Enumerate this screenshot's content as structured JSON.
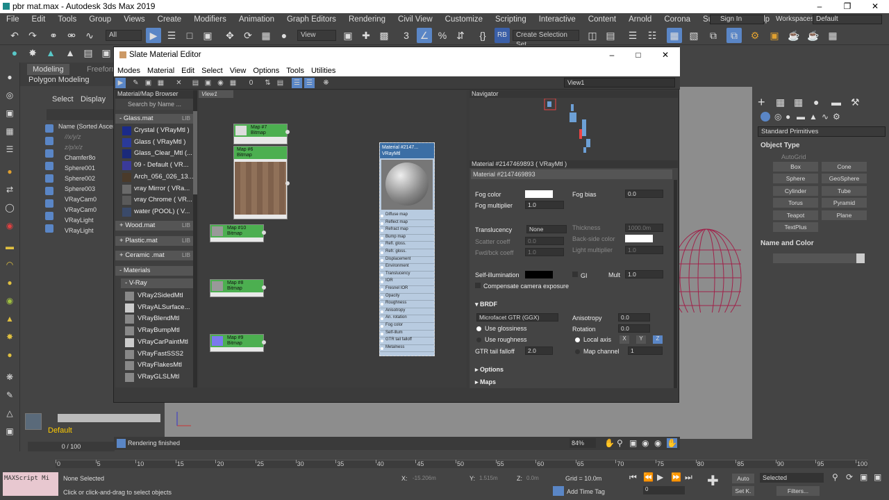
{
  "app": {
    "title": "pbr mat.max - Autodesk 3ds Max 2019",
    "sign_in": "Sign In",
    "workspaces_label": "Workspaces:",
    "workspace": "Default"
  },
  "menu": [
    "File",
    "Edit",
    "Tools",
    "Group",
    "Views",
    "Create",
    "Modifiers",
    "Animation",
    "Graph Editors",
    "Rendering",
    "Civil View",
    "Customize",
    "Scripting",
    "Interactive",
    "Content",
    "Arnold",
    "Corona",
    "Substance",
    "Help"
  ],
  "toolbar": {
    "filter": "All",
    "view_dropdown": "View",
    "create_selection_set": "Create Selection Set",
    "rb_label": "RB"
  },
  "ribbon": {
    "tabs": [
      "Modeling",
      "Freeform"
    ],
    "sub": "Polygon Modeling"
  },
  "scene": {
    "tabs": [
      "Select",
      "Display"
    ],
    "header": "Name (Sorted Ascen",
    "items": [
      "//x/y/z",
      "z/p/x/z",
      "Chamfer8o",
      "Sphere001",
      "Sphere002",
      "Sphere003",
      "VRayCam0",
      "VRayCam0",
      "VRayLight",
      "VRayLight"
    ]
  },
  "sme": {
    "title": "Slate Material Editor",
    "menu": [
      "Modes",
      "Material",
      "Edit",
      "Select",
      "View",
      "Options",
      "Tools",
      "Utilities"
    ],
    "view_dropdown": "View1",
    "browser": {
      "title": "Material/Map Browser",
      "search": "Search by Name ...",
      "lib": "LIB",
      "glass_group": "Glass.mat",
      "glass_items": [
        "Crystal  ( VRayMtl )",
        "Glass  ( VRayMtl )",
        "Glass_Clear_Mtl  (...",
        "09 - Default  ( VR...",
        "Arch_056_026_13...",
        "vray Mirror  ( VRa...",
        "vray Chrome  ( VR...",
        "water (POOL)  ( V..."
      ],
      "groups": [
        "Wood.mat",
        "Plastic.mat",
        "Ceramic .mat"
      ],
      "materials_group": "Materials",
      "vray_group": "V-Ray",
      "vray_items": [
        "VRay2SidedMtl",
        "VRayALSurface...",
        "VRayBlendMtl",
        "VRayBumpMtl",
        "VRayCarPaintMtl",
        "VRayFastSSS2",
        "VRayFlakesMtl",
        "VRayGLSLMtl"
      ]
    },
    "view1_tab": "View1",
    "nodes": [
      {
        "name": "Map #7",
        "type": "Bitmap"
      },
      {
        "name": "Map #6",
        "type": "Bitmap"
      },
      {
        "name": "Map #10",
        "type": "Bitmap"
      },
      {
        "name": "Map #8",
        "type": "Bitmap"
      },
      {
        "name": "Map #9",
        "type": "Bitmap"
      }
    ],
    "material_node": {
      "title": "Material #2147...",
      "subtitle": "VRayMtl",
      "slots": [
        "Diffuse map",
        "Reflect map",
        "Refract map",
        "Bump map",
        "Refl. gloss.",
        "Refr. gloss.",
        "Displacement",
        "Environment",
        "Translucency",
        "IOR",
        "Fresnel IOR",
        "Opacity",
        "Roughness",
        "Anisotropy",
        "An. rotation",
        "Fog color",
        "Self-illum",
        "GTR tail falloff",
        "Metalness"
      ]
    },
    "navigator": "Navigator",
    "props": {
      "header": "Material #2147469893  ( VRayMtl )",
      "name": "Material #2147469893",
      "fog_color": "Fog color",
      "fog_bias": "Fog bias",
      "fog_bias_val": "0.0",
      "fog_mult": "Fog multiplier",
      "fog_mult_val": "1.0",
      "translucency": "Translucency",
      "translucency_val": "None",
      "thickness": "Thickness",
      "thickness_val": "1000.0m",
      "scatter": "Scatter coeff",
      "scatter_val": "0.0",
      "backside": "Back-side color",
      "fwdbck": "Fwd/bck coeff",
      "fwdbck_val": "1.0",
      "lightmult": "Light multiplier",
      "lightmult_val": "1.0",
      "selfillum": "Self-illumination",
      "gi": "GI",
      "mult": "Mult",
      "mult_val": "1.0",
      "compensate": "Compensate camera exposure",
      "brdf": "BRDF",
      "brdf_type": "Microfacet GTR (GGX)",
      "anisotropy": "Anisotropy",
      "anisotropy_val": "0.0",
      "rotation": "Rotation",
      "rotation_val": "0.0",
      "use_gloss": "Use glossiness",
      "use_rough": "Use roughness",
      "local_axis": "Local axis",
      "axes": [
        "X",
        "Y",
        "Z"
      ],
      "gtr": "GTR tail falloff",
      "gtr_val": "2.0",
      "map_channel": "Map channel",
      "map_channel_val": "1",
      "options": "Options",
      "maps": "Maps"
    },
    "status": "Rendering finished",
    "zoom": "84%"
  },
  "cmd": {
    "dropdown": "Standard Primitives",
    "object_type": "Object Type",
    "autogrid": "AutoGrid",
    "buttons": [
      "Box",
      "Cone",
      "Sphere",
      "GeoSphere",
      "Cylinder",
      "Tube",
      "Torus",
      "Pyramid",
      "Teapot",
      "Plane",
      "TextPlus"
    ],
    "name_color": "Name and Color"
  },
  "bottom": {
    "layer": "Default",
    "frames": "0 / 100",
    "ticks": [
      "0",
      "5",
      "10",
      "15",
      "20",
      "25",
      "30",
      "35",
      "40",
      "45",
      "50",
      "55",
      "60",
      "65",
      "70",
      "75",
      "80",
      "85",
      "90",
      "95",
      "100"
    ],
    "maxscript": "MAXScript Mi",
    "none_selected": "None Selected",
    "hint": "Click or click-and-drag to select objects",
    "x": "X:",
    "x_val": "-15.206m",
    "y": "Y:",
    "y_val": "1.515m",
    "z": "Z:",
    "z_val": "0.0m",
    "grid": "Grid = 10.0m",
    "add_time_tag": "Add Time Tag",
    "auto": "Auto",
    "selected": "Selected",
    "setk": "Set K.",
    "filters": "Filters...",
    "frame": "0"
  }
}
